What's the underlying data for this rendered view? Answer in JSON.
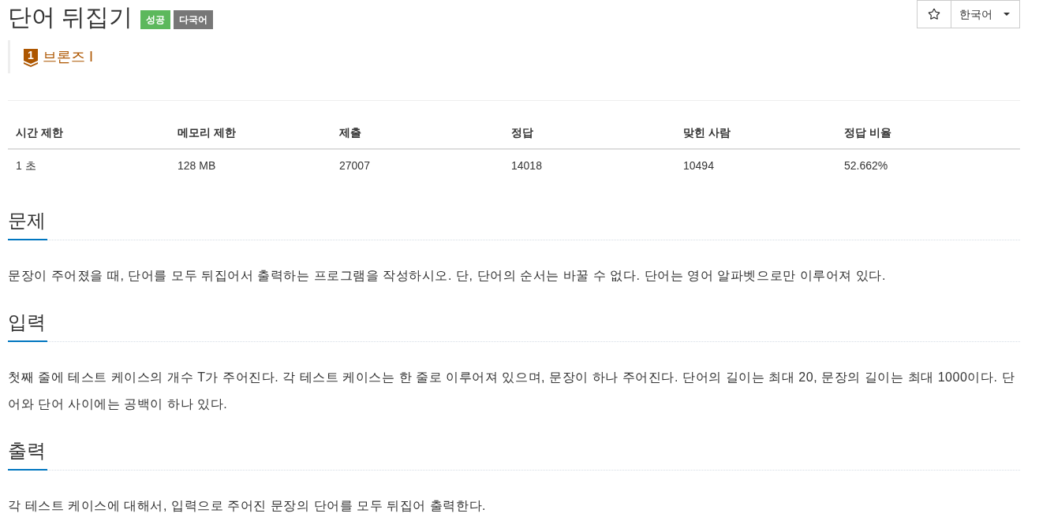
{
  "header": {
    "title": "단어 뒤집기",
    "badges": [
      {
        "text": "성공",
        "color": "#5cb85c"
      },
      {
        "text": "다국어",
        "color": "#777777"
      }
    ],
    "starred": false,
    "language": "한국어"
  },
  "tier": {
    "rank": "1",
    "name": "브론즈 I"
  },
  "table": {
    "columns": [
      "시간 제한",
      "메모리 제한",
      "제출",
      "정답",
      "맞힌 사람",
      "정답 비율"
    ],
    "rows": [
      [
        "1 초",
        "128 MB",
        "27007",
        "14018",
        "10494",
        "52.662%"
      ]
    ]
  },
  "sections": [
    {
      "title": "문제",
      "text": "문장이 주어졌을 때, 단어를 모두 뒤집어서 출력하는 프로그램을 작성하시오. 단, 단어의 순서는 바꿀 수 없다. 단어는 영어 알파벳으로만 이루어져 있다."
    },
    {
      "title": "입력",
      "text": "첫째 줄에 테스트 케이스의 개수 T가 주어진다. 각 테스트 케이스는 한 줄로 이루어져 있으며, 문장이 하나 주어진다. 단어의 길이는 최대 20, 문장의 길이는 최대 1000이다. 단어와 단어 사이에는 공백이 하나 있다."
    },
    {
      "title": "출력",
      "text": "각 테스트 케이스에 대해서, 입력으로 주어진 문장의 단어를 모두 뒤집어 출력한다."
    }
  ]
}
